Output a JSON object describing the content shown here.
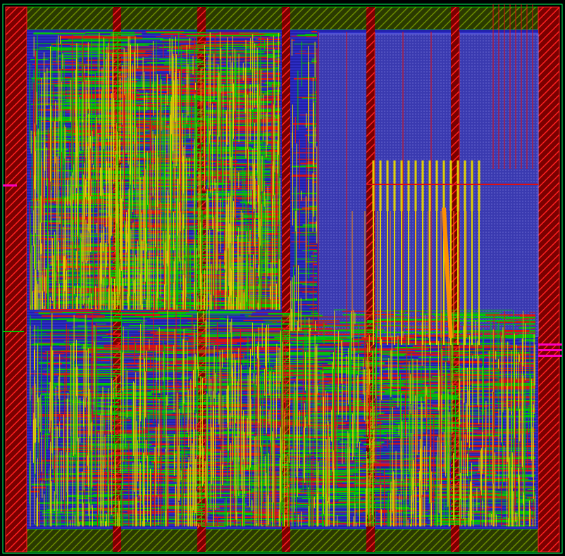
{
  "view": {
    "description_visible_text": "",
    "layers": [
      {
        "name": "metal1",
        "color": "#1010c8"
      },
      {
        "name": "metal2",
        "color": "#e01010"
      },
      {
        "name": "metal3",
        "color": "#00c800"
      },
      {
        "name": "metal4",
        "color": "#e0d000"
      },
      {
        "name": "metal5",
        "color": "#ff9000"
      },
      {
        "name": "boundary",
        "color": "#00ff60"
      },
      {
        "name": "pin",
        "color": "#ff00c0"
      }
    ]
  }
}
